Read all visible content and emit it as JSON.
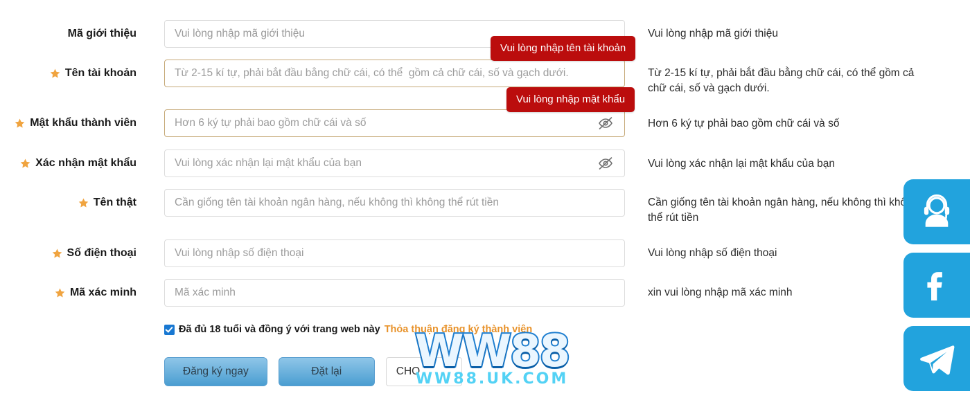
{
  "form": {
    "rows": [
      {
        "label": "Mã giới thiệu",
        "required": false,
        "placeholder": "Vui lòng nhập mã giới thiệu",
        "hint": "Vui lòng nhập mã giới thiệu",
        "eye": false,
        "warn": false
      },
      {
        "label": "Tên tài khoản",
        "required": true,
        "placeholder": "Từ 2-15 kí tự, phải bắt đầu bằng chữ cái, có thể  gồm cả chữ cái, số và gạch dưới.",
        "hint": "Từ 2-15 kí tự, phải bắt đầu bằng chữ cái, có thể gồm cả chữ cái, số và gạch dưới.",
        "eye": false,
        "warn": true
      },
      {
        "label": "Mật khẩu thành viên",
        "required": true,
        "placeholder": "Hơn 6 ký tự phải bao gồm chữ cái và số",
        "hint": "Hơn 6 ký tự phải bao gồm chữ cái và số",
        "eye": true,
        "warn": true
      },
      {
        "label": "Xác nhận mật khẩu",
        "required": true,
        "placeholder": "Vui lòng xác nhận lại mật khẩu của bạn",
        "hint": "Vui lòng xác nhận lại mật khẩu của bạn",
        "eye": true,
        "warn": false
      },
      {
        "label": "Tên thật",
        "required": true,
        "placeholder": "Cần giống tên tài khoản ngân hàng, nếu không thì không thể rút tiền",
        "hint": "Cần giống tên tài khoản ngân hàng, nếu không thì không thể rút tiền",
        "eye": false,
        "warn": false
      },
      {
        "label": "Số điện thoại",
        "required": true,
        "placeholder": "Vui lòng nhập số điện thoại",
        "hint": "Vui lòng nhập số điện thoại",
        "eye": false,
        "warn": false
      },
      {
        "label": "Mã xác minh",
        "required": true,
        "placeholder": "Mã xác minh",
        "hint": "xin vui lòng nhập mã xác minh",
        "eye": false,
        "warn": false
      }
    ],
    "tooltips": [
      {
        "text": "Vui lòng nhập tên tài khoản"
      },
      {
        "text": "Vui lòng nhập mật khẩu"
      }
    ],
    "agreement": {
      "text": "Đã đủ 18 tuổi và đồng ý với trang web này",
      "link": "Thỏa thuận đăng ký thành viên",
      "checked": true
    },
    "buttons": {
      "submit": "Đăng ký ngay",
      "reset": "Đặt lại",
      "captcha": "CHO"
    }
  },
  "watermark": {
    "main": "WW88",
    "sub": "WW88.UK.COM"
  },
  "social": {
    "items": [
      {
        "name": "support",
        "title": "Hỗ trợ khách hàng"
      },
      {
        "name": "facebook",
        "title": "Facebook"
      },
      {
        "name": "telegram",
        "title": "Telegram"
      }
    ]
  },
  "colors": {
    "star": "#f0a440",
    "tooltip_bg": "#bb0d0d",
    "button": "#4a9ed1",
    "social": "#22a3dd",
    "link": "#e8922a"
  }
}
